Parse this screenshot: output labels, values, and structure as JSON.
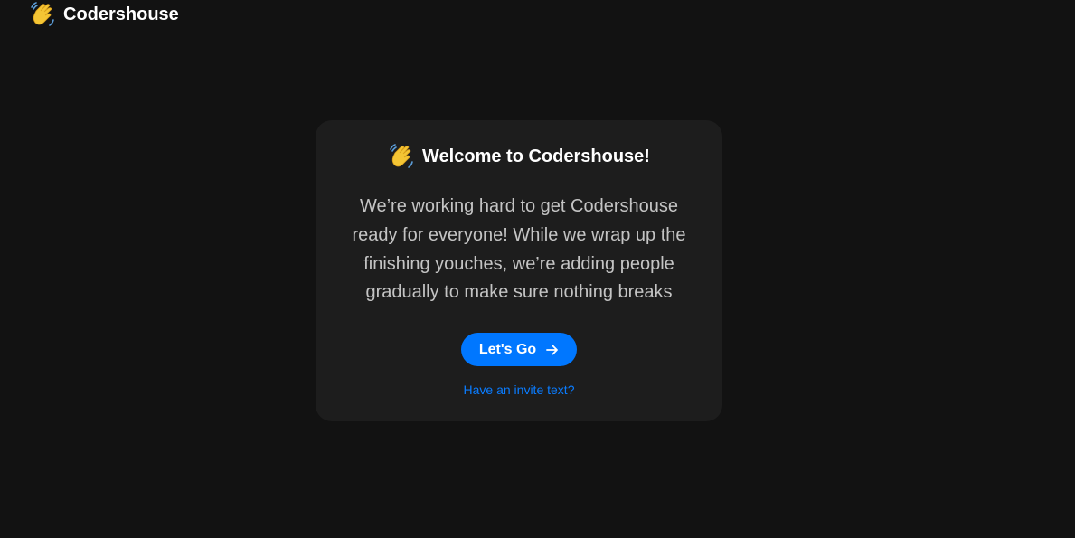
{
  "header": {
    "logo_icon": "waving-hand-icon",
    "brand_name": "Codershouse"
  },
  "card": {
    "icon": "waving-hand-icon",
    "title": "Welcome to Codershouse!",
    "body": "We’re working hard to get Codershouse ready for everyone! While we wrap up the finishing youches, we’re adding people gradually to make sure nothing breaks",
    "cta_label": "Let's Go",
    "cta_icon": "arrow-right-icon",
    "invite_link": "Have an invite text?"
  },
  "colors": {
    "background": "#121212",
    "card": "#1d1d1d",
    "accent": "#0077ff",
    "body_text": "#c4c4c4"
  }
}
